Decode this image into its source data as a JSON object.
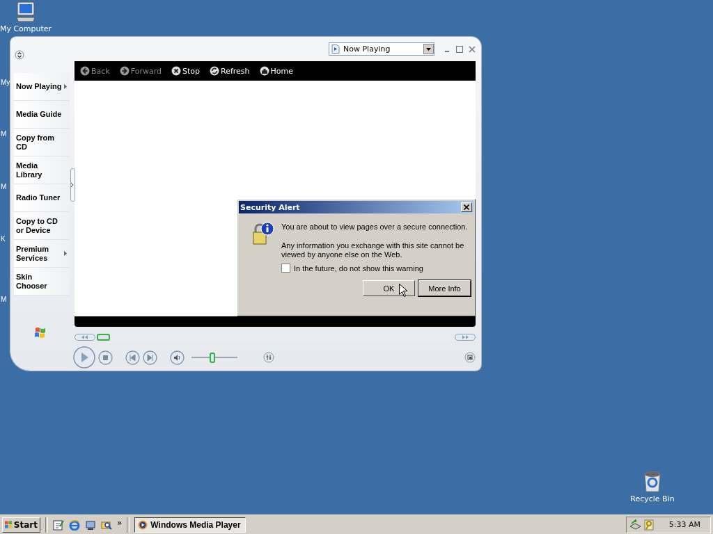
{
  "desktop": {
    "icons": [
      {
        "kind": "computer",
        "label": "My Computer"
      },
      {
        "kind": "recycle",
        "label": "Recycle Bin"
      }
    ],
    "cut_labels": [
      "My",
      "M",
      "M",
      "K",
      "M"
    ]
  },
  "player": {
    "view_select": {
      "value": "Now Playing"
    },
    "nav": [
      {
        "label": "Now Playing",
        "submenu": true
      },
      {
        "label": "Media Guide",
        "submenu": false
      },
      {
        "label": "Copy from CD",
        "submenu": false
      },
      {
        "label": "Media Library",
        "submenu": false
      },
      {
        "label": "Radio Tuner",
        "submenu": false
      },
      {
        "label": "Copy to CD or Device",
        "submenu": false
      },
      {
        "label": "Premium Services",
        "submenu": true
      },
      {
        "label": "Skin Chooser",
        "submenu": false
      }
    ],
    "toolbar": [
      {
        "kind": "back",
        "label": "Back",
        "disabled": true
      },
      {
        "kind": "forward",
        "label": "Forward",
        "disabled": true
      },
      {
        "kind": "stop",
        "label": "Stop",
        "disabled": false
      },
      {
        "kind": "refresh",
        "label": "Refresh",
        "disabled": false
      },
      {
        "kind": "home",
        "label": "Home",
        "disabled": false
      }
    ],
    "seek": {
      "level": 0.0
    },
    "volume": {
      "level": 0.45
    }
  },
  "dialog": {
    "title": "Security Alert",
    "messages": [
      "You are about to view pages over a secure connection.",
      "Any information you exchange with this site cannot be viewed by anyone else on the Web."
    ],
    "checkbox": {
      "label": "In the future, do not show this warning",
      "checked": false
    },
    "buttons": [
      {
        "label": "OK",
        "default": false
      },
      {
        "label": "More Info",
        "default": true
      }
    ]
  },
  "taskbar": {
    "start": "Start",
    "chevron": "»",
    "tasks": [
      {
        "label": "Windows Media Player",
        "selected": true
      }
    ],
    "clock": "5:33 AM"
  }
}
